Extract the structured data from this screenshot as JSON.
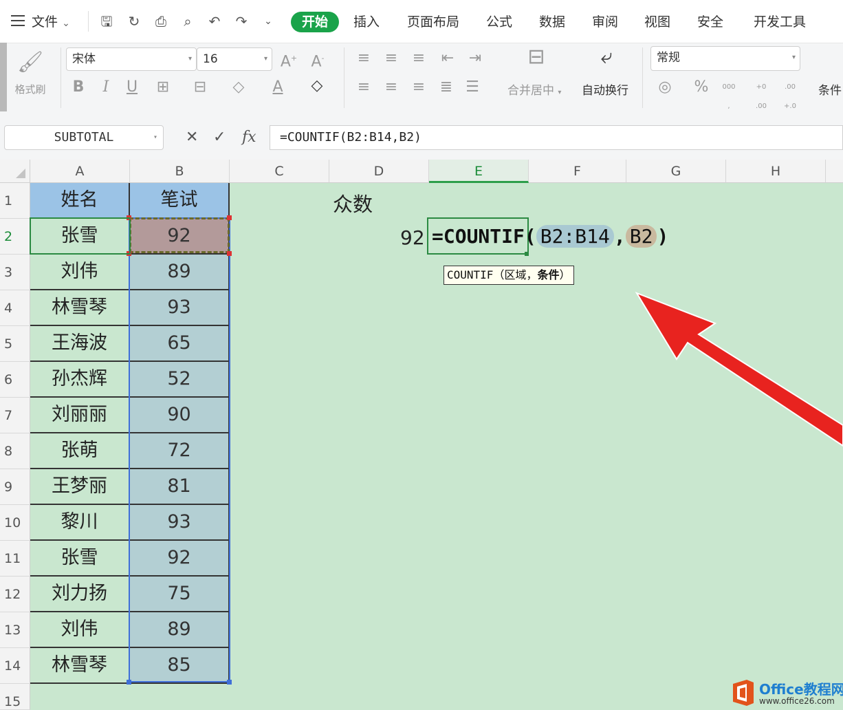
{
  "menu": {
    "file_label": "文件",
    "tabs": [
      "开始",
      "插入",
      "页面布局",
      "公式",
      "数据",
      "审阅",
      "视图",
      "安全",
      "开发工具"
    ],
    "active_tab": "开始"
  },
  "ribbon": {
    "format_brush": "格式刷",
    "font_name": "宋体",
    "font_size": "16",
    "merge_center": "合并居中",
    "auto_wrap": "自动换行",
    "number_format": "常规",
    "conditional_partial": "条件"
  },
  "formula_bar": {
    "name_box": "SUBTOTAL",
    "fx_label": "fx",
    "formula": "=COUNTIF(B2:B14,B2)"
  },
  "grid": {
    "columns": [
      "A",
      "B",
      "C",
      "D",
      "E",
      "F",
      "G",
      "H"
    ],
    "selected_column": "E",
    "row_numbers": [
      "1",
      "2",
      "3",
      "4",
      "5",
      "6",
      "7",
      "8",
      "9",
      "10",
      "11",
      "12",
      "13",
      "14",
      "15"
    ],
    "headers": {
      "A": "姓名",
      "B": "笔试"
    },
    "rows": [
      {
        "name": "张雪",
        "score": "92"
      },
      {
        "name": "刘伟",
        "score": "89"
      },
      {
        "name": "林雪琴",
        "score": "93"
      },
      {
        "name": "王海波",
        "score": "65"
      },
      {
        "name": "孙杰辉",
        "score": "52"
      },
      {
        "name": "刘丽丽",
        "score": "90"
      },
      {
        "name": "张萌",
        "score": "72"
      },
      {
        "name": "王梦丽",
        "score": "81"
      },
      {
        "name": "黎川",
        "score": "93"
      },
      {
        "name": "张雪",
        "score": "92"
      },
      {
        "name": "刘力扬",
        "score": "75"
      },
      {
        "name": "刘伟",
        "score": "89"
      },
      {
        "name": "林雪琴",
        "score": "85"
      }
    ],
    "mode_title": "众数",
    "mode_value": "92",
    "edit_formula": {
      "prefix": "=COUNTIF(",
      "arg1": "B2:B14",
      "sep": ",",
      "arg2": "B2",
      "suffix": ")"
    },
    "tooltip": {
      "fn": "COUNTIF",
      "open": "（",
      "arg1": "区域",
      "sep": "，",
      "arg2": "条件",
      "close": "）"
    }
  },
  "watermark": {
    "title": "Office教程网",
    "url": "www.office26.com"
  },
  "colors": {
    "accent_green": "#1aa34a",
    "sheet_bg": "#c9e7cf",
    "header_blue": "#9bc3e6",
    "arrow_red": "#e8231f"
  }
}
